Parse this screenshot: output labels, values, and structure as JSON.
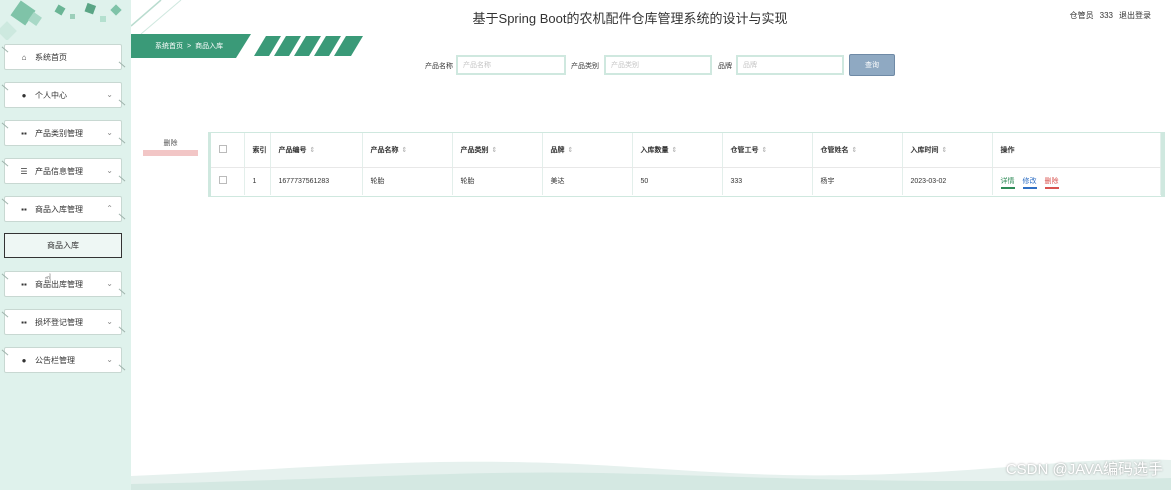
{
  "app": {
    "title": "基于Spring Boot的农机配件仓库管理系统的设计与实现"
  },
  "user": {
    "role_label": "仓管员",
    "user_id": "333",
    "logout_label": "退出登录"
  },
  "breadcrumb": {
    "home": "系统首页",
    "separator": ">",
    "current": "商品入库"
  },
  "sidebar": {
    "items": [
      {
        "label": "系统首页",
        "icon": "home-icon"
      },
      {
        "label": "个人中心",
        "icon": "person-icon",
        "chevron": "down"
      },
      {
        "label": "产品类别管理",
        "icon": "grid-icon",
        "chevron": "down"
      },
      {
        "label": "产品信息管理",
        "icon": "list-icon",
        "chevron": "down"
      },
      {
        "label": "商品入库管理",
        "icon": "grid-icon",
        "chevron": "up"
      },
      {
        "label": "商品出库管理",
        "icon": "grid-icon",
        "chevron": "down"
      },
      {
        "label": "损坏登记管理",
        "icon": "grid-icon",
        "chevron": "down"
      },
      {
        "label": "公告栏管理",
        "icon": "person-icon",
        "chevron": "down"
      }
    ],
    "submenu": {
      "label": "商品入库"
    }
  },
  "search": {
    "product_name_label": "产品名称",
    "product_name_placeholder": "产品名称",
    "category_label": "产品类别",
    "category_placeholder": "产品类别",
    "brand_label": "品牌",
    "brand_placeholder": "品牌",
    "query_label": "查询"
  },
  "actions": {
    "delete_label": "删除"
  },
  "table": {
    "headers": [
      "索引",
      "产品编号",
      "产品名称",
      "产品类别",
      "品牌",
      "入库数量",
      "仓管工号",
      "仓管姓名",
      "入库时间",
      "操作"
    ],
    "rows": [
      {
        "index": "1",
        "product_no": "1677737561283",
        "name": "轮胎",
        "category": "轮胎",
        "brand": "美达",
        "quantity": "50",
        "staff_no": "333",
        "staff_name": "杨宇",
        "time": "2023-03-02"
      }
    ],
    "ops": {
      "detail": "详情",
      "edit": "修改",
      "delete": "删除"
    }
  },
  "watermark": "CSDN @JAVA编码选手",
  "colors": {
    "sidebar_bg": "#dff2ec",
    "accent": "#3a9a78",
    "query_btn": "#8fa9c2",
    "delete_red": "#d9534f",
    "edit_blue": "#2f6fc4",
    "detail_green": "#2e8b57"
  }
}
